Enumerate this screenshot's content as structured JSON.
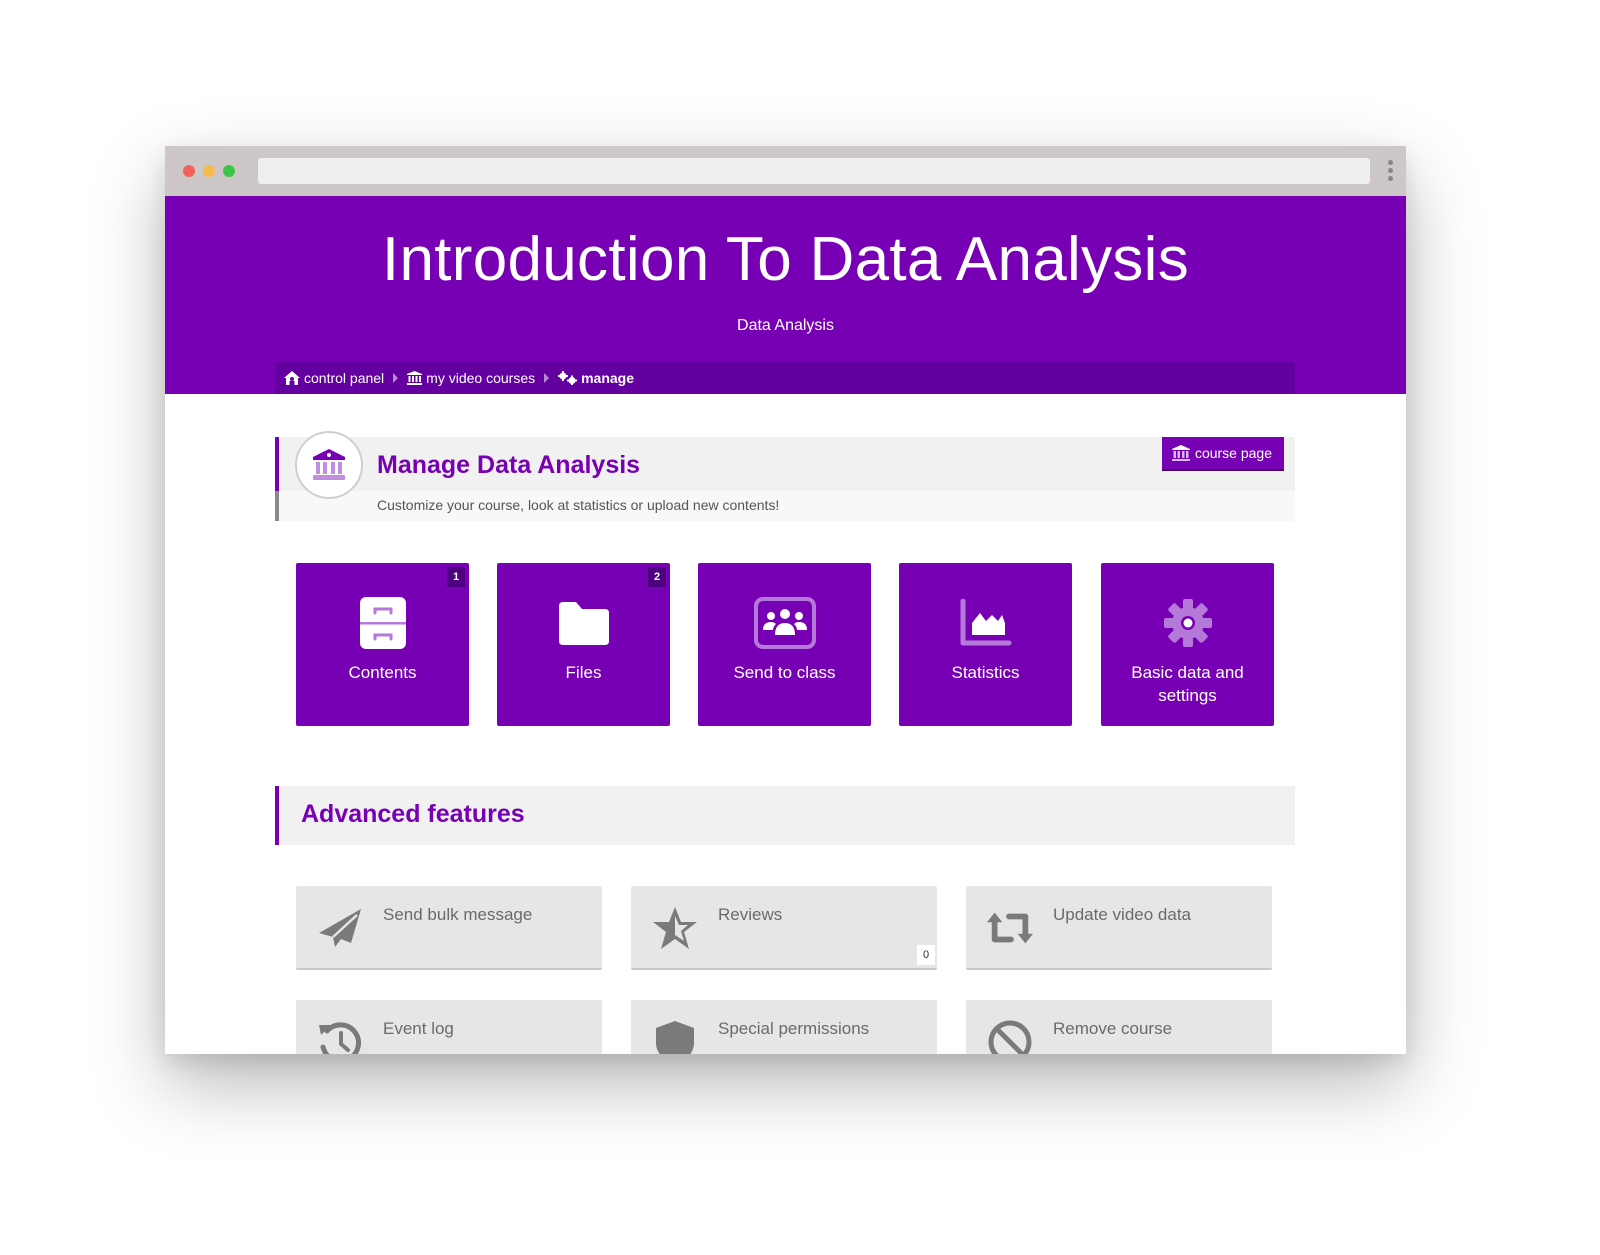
{
  "browser": {
    "window_controls": [
      "close",
      "minimize",
      "maximize"
    ],
    "address_bar_value": ""
  },
  "colors": {
    "brand_purple": "#7800b4",
    "breadcrumb_bg": "#6400a0",
    "feature_gray": "#e6e6e6",
    "feature_text": "#6a6a6a"
  },
  "hero": {
    "title": "Introduction To Data Analysis",
    "subtitle": "Data Analysis"
  },
  "breadcrumb": [
    {
      "label": "control panel",
      "icon": "home-icon"
    },
    {
      "label": "my video courses",
      "icon": "institution-icon"
    },
    {
      "label": "manage",
      "icon": "gears-icon"
    }
  ],
  "manage": {
    "title_prefix": "Manage",
    "title_name": "Data Analysis",
    "description": "Customize your course, look at statistics or upload new contents!",
    "course_page_button": "course page"
  },
  "tiles": [
    {
      "label": "Contents",
      "icon": "file-cabinet-icon",
      "badge": "1"
    },
    {
      "label": "Files",
      "icon": "folder-icon",
      "badge": "2"
    },
    {
      "label": "Send to class",
      "icon": "users-screen-icon",
      "badge": null
    },
    {
      "label": "Statistics",
      "icon": "area-chart-icon",
      "badge": null
    },
    {
      "label": "Basic data and settings",
      "icon": "gear-icon",
      "badge": null
    }
  ],
  "advanced": {
    "title": "Advanced features",
    "items": [
      {
        "label": "Send bulk message",
        "icon": "paper-plane-icon",
        "badge": null
      },
      {
        "label": "Reviews",
        "icon": "star-half-icon",
        "badge": "0"
      },
      {
        "label": "Update video data",
        "icon": "retweet-icon",
        "badge": null
      },
      {
        "label": "Event log",
        "icon": "history-icon",
        "badge": null
      },
      {
        "label": "Special permissions",
        "icon": "shield-icon",
        "badge": null
      },
      {
        "label": "Remove course",
        "icon": "ban-icon",
        "badge": null
      }
    ]
  }
}
